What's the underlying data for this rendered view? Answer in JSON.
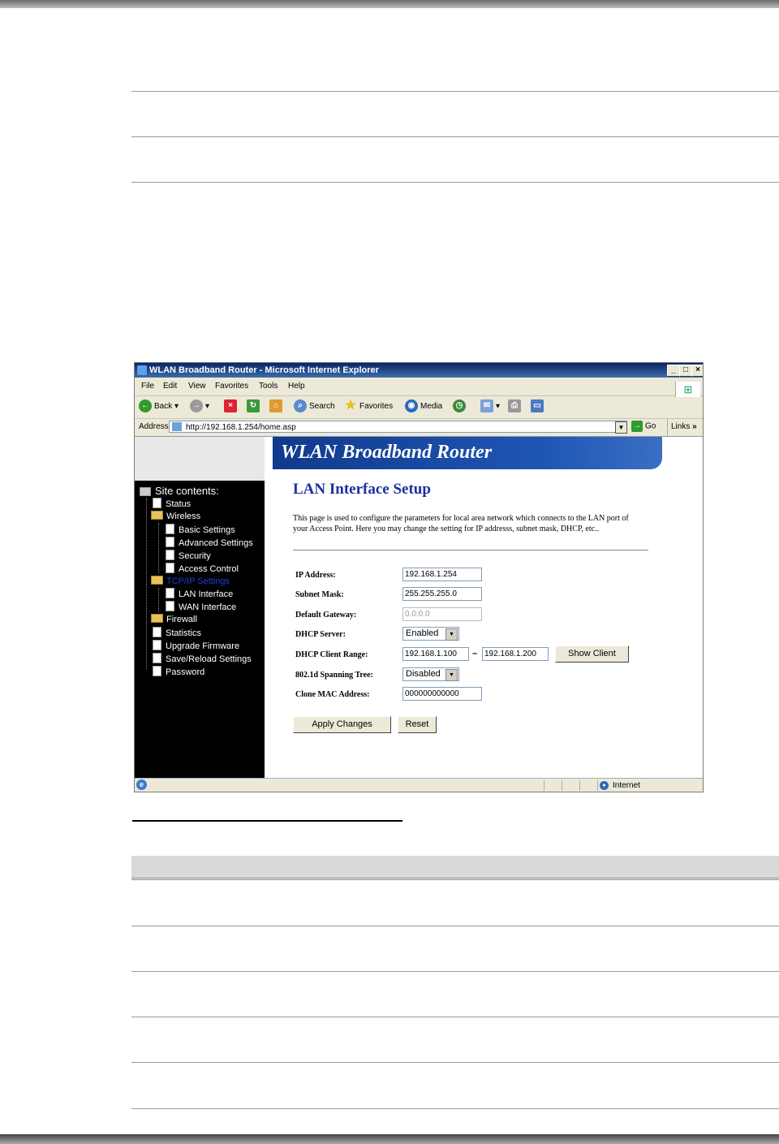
{
  "window": {
    "title": "WLAN Broadband Router - Microsoft Internet Explorer",
    "minimize": "_",
    "maximize": "□",
    "close": "×"
  },
  "menu": [
    "File",
    "Edit",
    "View",
    "Favorites",
    "Tools",
    "Help"
  ],
  "toolbar": {
    "back": "Back",
    "search": "Search",
    "favorites": "Favorites",
    "media": "Media"
  },
  "address": {
    "label": "Address",
    "url": "http://192.168.1.254/home.asp",
    "go": "Go",
    "links": "Links",
    "more": "»"
  },
  "banner": {
    "title": "WLAN Broadband Router"
  },
  "sidebar": {
    "heading": "Site contents:",
    "items": [
      {
        "label": "Status"
      },
      {
        "label": "Wireless"
      },
      {
        "label": "Basic Settings"
      },
      {
        "label": "Advanced Settings"
      },
      {
        "label": "Security"
      },
      {
        "label": "Access Control"
      },
      {
        "label": "TCP/IP Settings"
      },
      {
        "label": "LAN Interface"
      },
      {
        "label": "WAN Interface"
      },
      {
        "label": "Firewall"
      },
      {
        "label": "Statistics"
      },
      {
        "label": "Upgrade Firmware"
      },
      {
        "label": "Save/Reload Settings"
      },
      {
        "label": "Password"
      }
    ]
  },
  "page": {
    "title": "LAN Interface Setup",
    "description": "This page is used to configure the parameters for local area network which connects to the LAN port of your Access Point. Here you may change the setting for IP addresss, subnet mask, DHCP, etc..",
    "fields": {
      "ip_label": "IP Address:",
      "ip_value": "192.168.1.254",
      "subnet_label": "Subnet Mask:",
      "subnet_value": "255.255.255.0",
      "gateway_label": "Default Gateway:",
      "gateway_value": "0.0.0.0",
      "dhcp_label": "DHCP Server:",
      "dhcp_value": "Enabled",
      "range_label": "DHCP Client Range:",
      "range_start": "192.168.1.100",
      "range_dash": "–",
      "range_end": "192.168.1.200",
      "show_client": "Show Client",
      "stp_label": "802.1d Spanning Tree:",
      "stp_value": "Disabled",
      "mac_label": "Clone MAC Address:",
      "mac_value": "000000000000"
    },
    "apply": "Apply Changes",
    "reset": "Reset"
  },
  "status": {
    "zone": "Internet"
  }
}
